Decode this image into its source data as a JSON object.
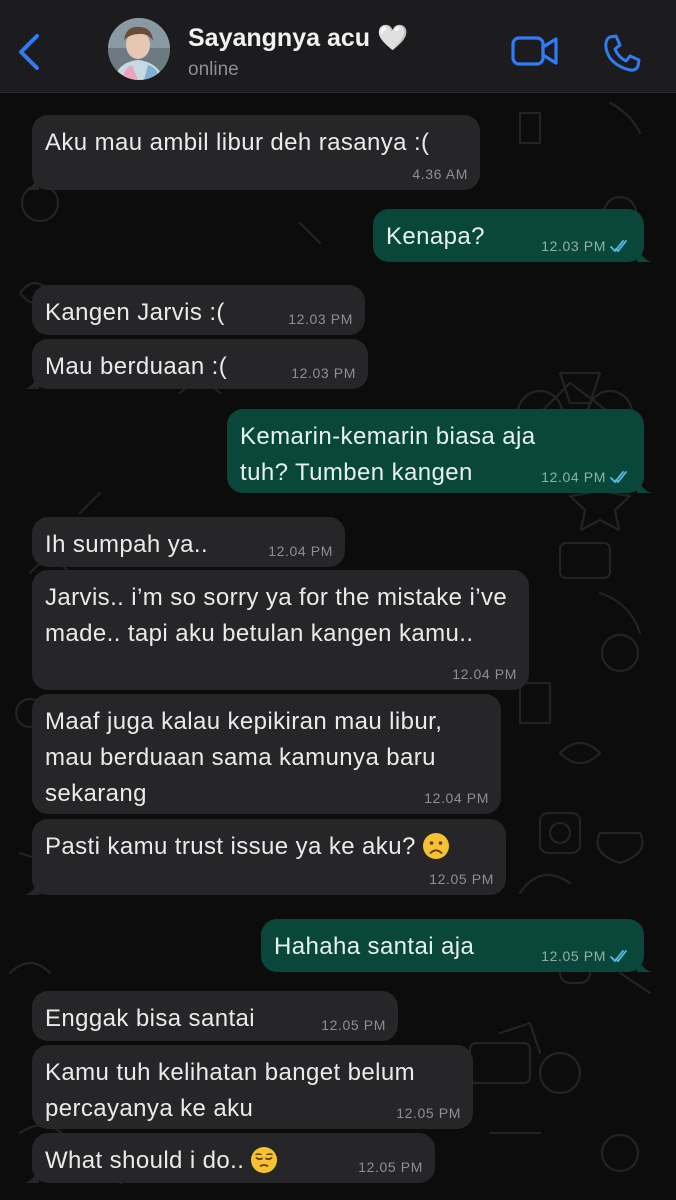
{
  "header": {
    "contact_name": "Sayangnya acu 🤍",
    "status": "online"
  },
  "colors": {
    "accent": "#2f7cf6",
    "incoming_bubble": "#262628",
    "outgoing_bubble": "#0a473b",
    "read_ticks": "#53bdeb"
  },
  "icons": {
    "back": "chevron-left-icon",
    "video": "video-camera-icon",
    "call": "phone-icon",
    "read_receipt": "double-check-icon"
  },
  "messages": [
    {
      "dir": "in",
      "text": "Aku mau ambil libur deh rasanya :(",
      "time": "4.36 AM"
    },
    {
      "dir": "out",
      "text": "Kenapa?",
      "time": "12.03 PM",
      "status": "read"
    },
    {
      "dir": "in",
      "text": "Kangen Jarvis :(",
      "time": "12.03 PM"
    },
    {
      "dir": "in",
      "text": "Mau berduaan :(",
      "time": "12.03 PM"
    },
    {
      "dir": "out",
      "text": "Kemarin-kemarin biasa aja tuh? Tumben kangen",
      "time": "12.04 PM",
      "status": "read"
    },
    {
      "dir": "in",
      "text": "Ih sumpah ya..",
      "time": "12.04 PM"
    },
    {
      "dir": "in",
      "text": "Jarvis.. i’m so sorry ya for the mistake i’ve made.. tapi aku betulan kangen kamu..",
      "time": "12.04 PM"
    },
    {
      "dir": "in",
      "text": "Maaf juga kalau kepikiran mau libur, mau berduaan sama kamunya baru sekarang",
      "time": "12.04 PM"
    },
    {
      "dir": "in",
      "text": "Pasti kamu trust issue ya ke aku?",
      "emoji": "frowning-face",
      "time": "12.05 PM"
    },
    {
      "dir": "out",
      "text": "Hahaha santai aja",
      "time": "12.05 PM",
      "status": "read"
    },
    {
      "dir": "in",
      "text": "Enggak bisa santai",
      "time": "12.05 PM"
    },
    {
      "dir": "in",
      "text": "Kamu tuh kelihatan banget belum percayanya ke aku",
      "time": "12.05 PM"
    },
    {
      "dir": "in",
      "text": "What should i do..",
      "emoji": "pensive-face",
      "time": "12.05 PM"
    }
  ]
}
